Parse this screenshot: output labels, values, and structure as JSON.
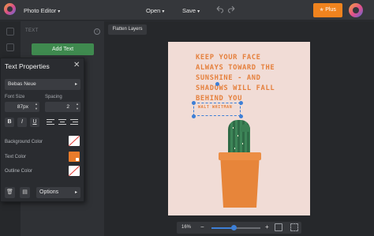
{
  "colors": {
    "accent": "#f0831e",
    "add_text_green": "#3f8a4f",
    "selection_blue": "#3d7fd6",
    "text_color": "#ea7c2b",
    "artboard_bg": "#f1dcd6"
  },
  "topbar": {
    "title": "Photo Editor",
    "open_label": "Open",
    "save_label": "Save",
    "plus_label": "Plus",
    "icons": [
      "undo-icon",
      "redo-icon",
      "star-icon",
      "avatar"
    ]
  },
  "toolpanel": {
    "heading": "TEXT",
    "add_text_label": "Add Text"
  },
  "canvas": {
    "flatten_label": "Flatten Layers"
  },
  "text_properties": {
    "title": "Text Properties",
    "font": "Bebas Neue",
    "font_size_label": "Font Size",
    "font_size": "87px",
    "spacing_label": "Spacing",
    "spacing": "2",
    "format_buttons": [
      "B",
      "I",
      "U"
    ],
    "background_color_label": "Background Color",
    "text_color_label": "Text Color",
    "outline_color_label": "Outline Color",
    "options_label": "Options"
  },
  "artboard": {
    "quote_lines": [
      "KEEP YOUR FACE",
      "ALWAYS TOWARD THE",
      "SUNSHINE - AND",
      "SHADOWS WILL FALL",
      "BEHIND YOU"
    ],
    "author": "WALT WHITMAN"
  },
  "zoom": {
    "value_label": "16%",
    "level_fraction": 0.45
  }
}
